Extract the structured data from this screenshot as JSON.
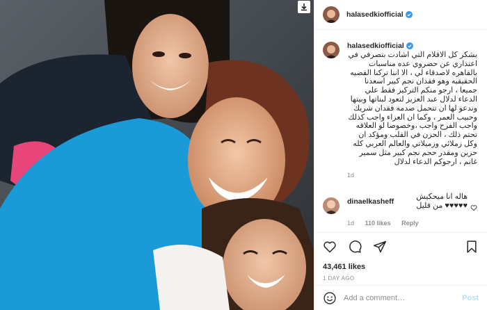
{
  "post": {
    "username": "halasedkiofficial",
    "caption": "بشكر كل الاقلام التي اشادت بتصرفي في اعتذاري عن حضروي عده مناسبات بالقاهره لاصدقاء لي ، الا اننا تركنا القضيه الحقيقيه وهو فقدان نجم كبير اسعدنا جميعا ، ارجو منكم التركيز فقط علي الدعاء لدلال عبد العزيز لتعود لبناتها وبيتها وندعو لها ان تتحمل صدمه فقدان شريك وحبيب العمر ، وكما ان العزاء واجب كذلك واجب الفرح واجب ،وخصوصا لو العلاقه تحتم ذلك ، الحزن في القلب ومؤكد ان وكل زملائي وزميلاتي والعالم العربي كله حزين ومقدر حجم نجم كبير مثل سمير غانم ، ارجوكم الدعاء لدلال",
    "caption_time": "1d"
  },
  "comment": {
    "username": "dinaelkasheff",
    "text": "هاله انا ميحكيش ♥♥♥♥♥ من قليل",
    "time": "1d",
    "likes": "110 likes",
    "reply_label": "Reply"
  },
  "stats": {
    "likes": "43,461 likes",
    "time_ago": "1 DAY AGO"
  },
  "add_comment": {
    "placeholder": "Add a comment…",
    "post_label": "Post"
  },
  "icons": {
    "download": "download-icon",
    "heart": "heart-icon",
    "comment": "comment-icon",
    "share": "share-icon",
    "bookmark": "bookmark-icon",
    "emoji": "emoji-icon",
    "verified": "verified-badge-icon"
  },
  "colors": {
    "verified_blue": "#3897f0",
    "post_button_disabled": "#b2dffc",
    "muted_text": "#8e8e8e"
  }
}
